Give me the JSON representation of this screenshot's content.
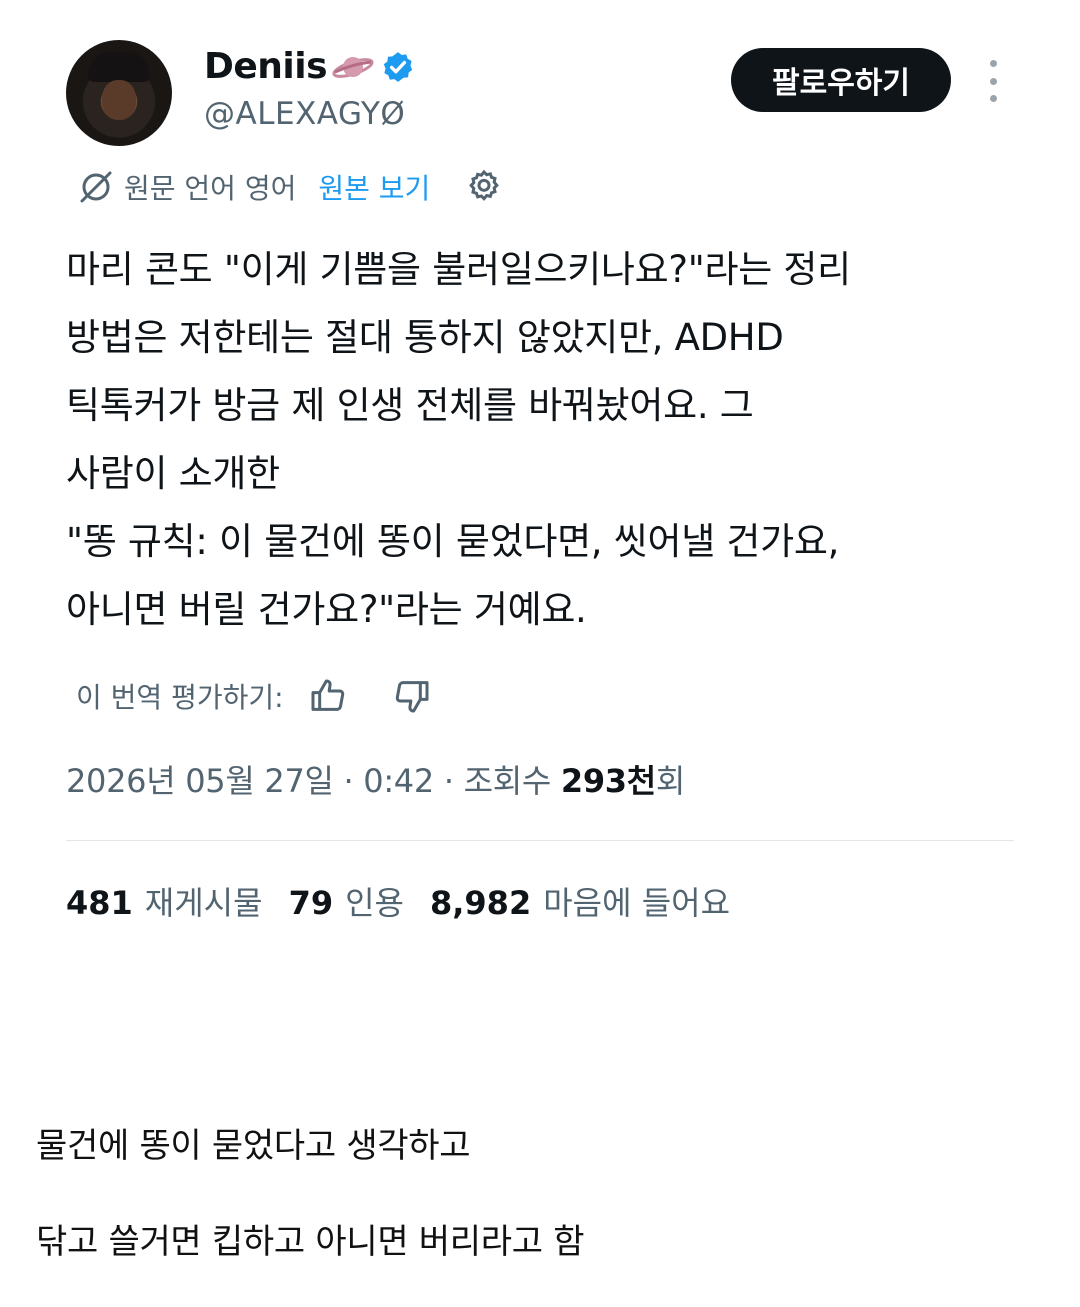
{
  "tweet": {
    "author": {
      "display_name": "Deniis",
      "handle": "@ALEXAGYØ",
      "emoji_icon": "ringed-planet-icon",
      "verified_icon": "verified-badge-icon"
    },
    "follow_label": "팔로우하기",
    "translation_bar": {
      "source_text": "원문 언어 영어",
      "view_original_label": "원본 보기"
    },
    "body_lines": [
      "마리 콘도 \"이게 기쁨을 불러일으키나요?\"라는 정리",
      "방법은 저한테는 절대 통하지 않았지만, ADHD",
      "틱톡커가 방금 제 인생 전체를 바꿔놨어요. 그",
      "사람이 소개한",
      "\"똥 규칙: 이 물건에 똥이 묻었다면, 씻어낼 건가요,",
      "아니면 버릴 건가요?\"라는 거예요."
    ],
    "rate_label": "이 번역 평가하기:",
    "meta": {
      "date": "2026년 05월 27일",
      "time": "0:42",
      "views_label": "조회수",
      "views_value": "293천",
      "views_suffix": "회",
      "separator": "·"
    },
    "stats": {
      "reposts_count": "481",
      "reposts_label": "재게시물",
      "quotes_count": "79",
      "quotes_label": "인용",
      "likes_count": "8,982",
      "likes_label": "마음에 들어요"
    }
  },
  "caption": {
    "line1": "물건에 똥이 묻었다고 생각하고",
    "line2": "닦고 쓸거면 킵하고 아니면 버리라고 함"
  },
  "colors": {
    "text": "#0f1419",
    "secondary": "#536471",
    "link": "#1d9bf0",
    "follow_bg": "#0f1419"
  }
}
